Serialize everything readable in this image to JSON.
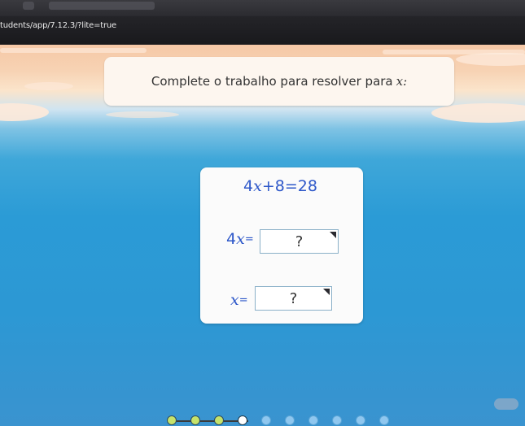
{
  "browser": {
    "url_fragment": "tudents/app/7.12.3/?lite=true"
  },
  "prompt": {
    "text": "Complete o trabalho para resolver para",
    "variable": "x:"
  },
  "card": {
    "given": {
      "coef": "4",
      "var": "x",
      "rest": "+8=28"
    },
    "step1": {
      "coef": "4",
      "var": "x",
      "eq": "="
    },
    "step2": {
      "var": "x",
      "eq": "="
    },
    "placeholder": "?"
  },
  "progress": {
    "total": 10,
    "completed": 3,
    "current": 4
  },
  "colors": {
    "equation": "#2e58c9",
    "dot_done": "#c6e36b",
    "dot_current": "#ffffff",
    "dot_todo": "#8fc7ef"
  }
}
